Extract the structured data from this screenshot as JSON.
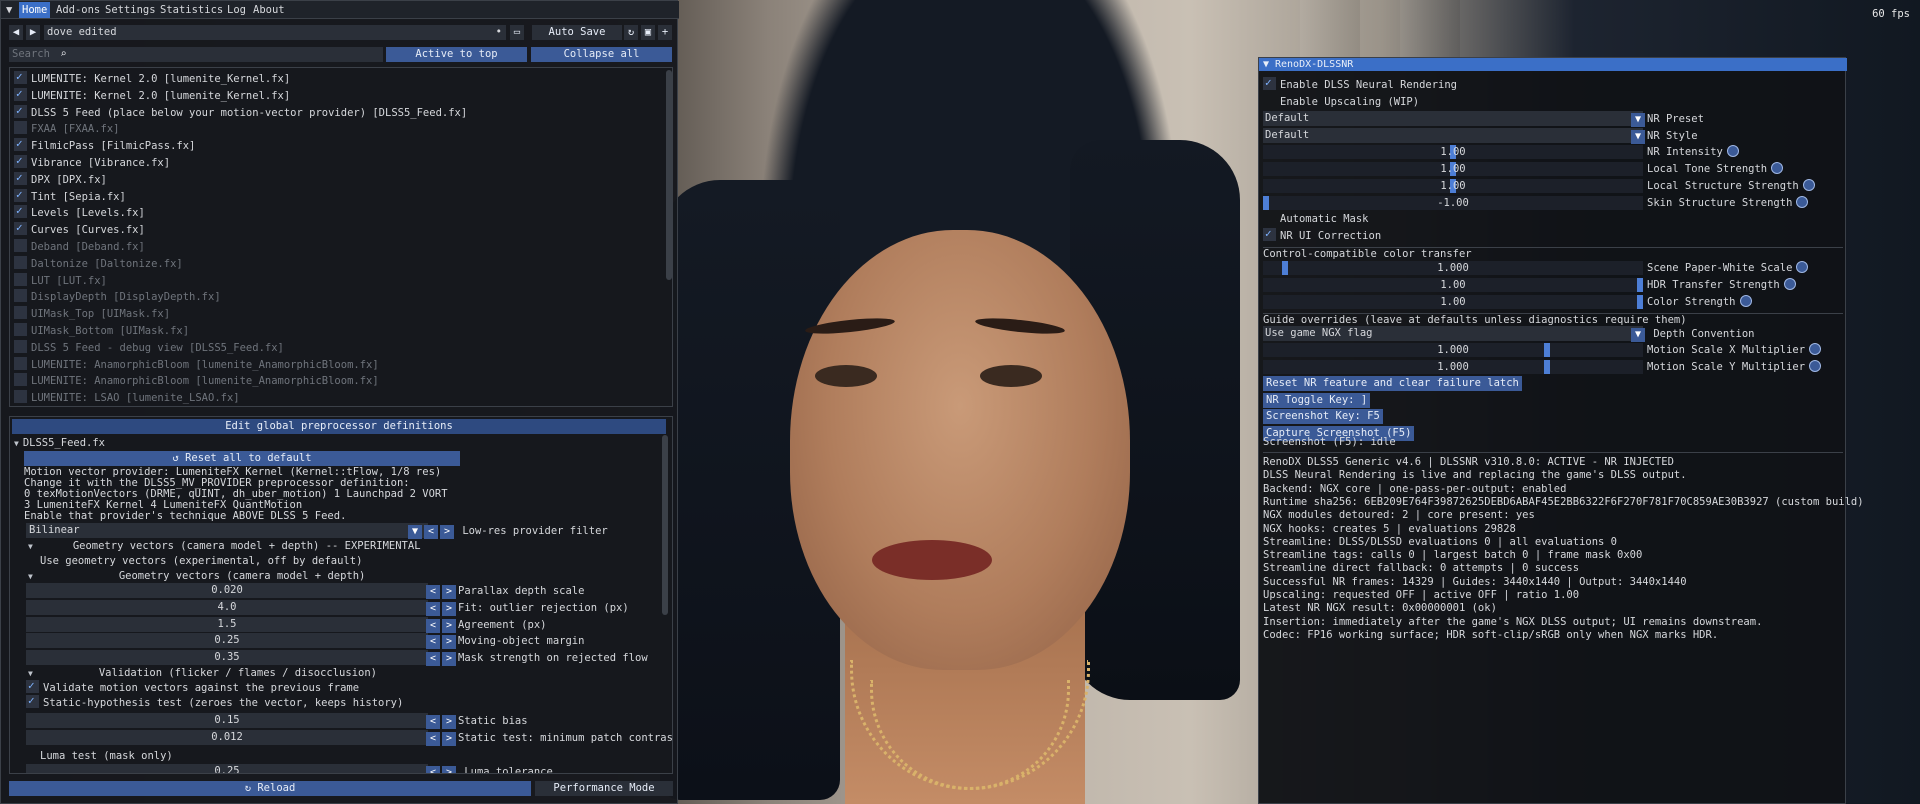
{
  "fps": "60 fps",
  "reshade": {
    "menu": [
      "Home",
      "Add-ons",
      "Settings",
      "Statistics",
      "Log",
      "About"
    ],
    "preset_name": "dove edited",
    "auto_save": "Auto Save",
    "search_placeholder": "Search",
    "active_to_top": "Active to top",
    "collapse_all": "Collapse all",
    "effects": [
      {
        "label": "LUMENITE: Kernel 2.0 [lumenite_Kernel.fx]",
        "on": true
      },
      {
        "label": "LUMENITE: Kernel 2.0 [lumenite_Kernel.fx]",
        "on": true
      },
      {
        "label": "DLSS 5 Feed (place below your motion-vector provider) [DLSS5_Feed.fx]",
        "on": true
      },
      {
        "label": "FXAA [FXAA.fx]",
        "on": false
      },
      {
        "label": "FilmicPass [FilmicPass.fx]",
        "on": true
      },
      {
        "label": "Vibrance [Vibrance.fx]",
        "on": true
      },
      {
        "label": "DPX [DPX.fx]",
        "on": true
      },
      {
        "label": "Tint [Sepia.fx]",
        "on": true
      },
      {
        "label": "Levels [Levels.fx]",
        "on": true
      },
      {
        "label": "Curves [Curves.fx]",
        "on": true
      },
      {
        "label": "Deband [Deband.fx]",
        "on": false
      },
      {
        "label": "Daltonize [Daltonize.fx]",
        "on": false
      },
      {
        "label": "LUT [LUT.fx]",
        "on": false
      },
      {
        "label": "DisplayDepth [DisplayDepth.fx]",
        "on": false
      },
      {
        "label": "UIMask_Top [UIMask.fx]",
        "on": false
      },
      {
        "label": "UIMask_Bottom [UIMask.fx]",
        "on": false
      },
      {
        "label": "DLSS 5 Feed - debug view [DLSS5_Feed.fx]",
        "on": false
      },
      {
        "label": "LUMENITE: AnamorphicBloom [lumenite_AnamorphicBloom.fx]",
        "on": false
      },
      {
        "label": "LUMENITE: AnamorphicBloom [lumenite_AnamorphicBloom.fx]",
        "on": false
      },
      {
        "label": "LUMENITE: LSAO [lumenite_LSAO.fx]",
        "on": false
      }
    ],
    "edit_global": "Edit global preprocessor definitions",
    "section_file": "DLSS5_Feed.fx",
    "reset_all": "Reset all to default",
    "info_lines": [
      "Motion vector provider: LumeniteFX Kernel (Kernel::tFlow, 1/8 res)",
      "Change it with the DLSS5_MV_PROVIDER preprocessor definition:",
      "  0 texMotionVectors (DRME, qUINT, dh_uber_motion)   1 Launchpad   2 VORT",
      "  3 LumeniteFX Kernel    4 LumeniteFX QuantMotion",
      "Enable that provider's technique ABOVE DLSS 5 Feed."
    ],
    "lowres_value": "Bilinear",
    "lowres_label": "Low-res provider filter",
    "geo_header_exp": "Geometry vectors (camera model + depth) -- EXPERIMENTAL",
    "use_geo": "Use geometry vectors (experimental, off by default)",
    "geo_header": "Geometry vectors (camera model + depth)",
    "params_geo": [
      {
        "value": "0.020",
        "label": "Parallax depth scale"
      },
      {
        "value": "4.0",
        "label": "Fit: outlier rejection (px)"
      },
      {
        "value": "1.5",
        "label": "Agreement (px)"
      },
      {
        "value": "0.25",
        "label": "Moving-object margin"
      },
      {
        "value": "0.35",
        "label": "Mask strength on rejected flow"
      }
    ],
    "validation_header": "Validation (flicker / flames / disocclusion)",
    "validate_mv": "Validate motion vectors against the previous frame",
    "static_hyp": "Static-hypothesis test (zeroes the vector, keeps history)",
    "params_static": [
      {
        "value": "0.15",
        "label": "Static bias"
      },
      {
        "value": "0.012",
        "label": "Static test: minimum patch contrast"
      }
    ],
    "luma_test": "Luma test (mask only)",
    "luma_tol_value": "0.25",
    "luma_tol_label": "Luma tolerance",
    "reload": "Reload",
    "perf_mode": "Performance Mode"
  },
  "renodx": {
    "title": "RenoDX-DLSSNR",
    "enable_nr": "Enable DLSS Neural Rendering",
    "enable_upscaling": "Enable Upscaling (WIP)",
    "combos": [
      {
        "value": "Default",
        "label": "NR Preset"
      },
      {
        "value": "Default",
        "label": "NR Style"
      }
    ],
    "sliders_a": [
      {
        "value": "1.00",
        "label": "NR Intensity",
        "frac": 0.5
      },
      {
        "value": "1.00",
        "label": "Local Tone Strength",
        "frac": 0.5
      },
      {
        "value": "1.00",
        "label": "Local Structure Strength",
        "frac": 0.5
      },
      {
        "value": "-1.00",
        "label": "Skin Structure Strength",
        "frac": 0.0
      }
    ],
    "auto_mask": "Automatic Mask",
    "nr_ui": "NR UI Correction",
    "color_transfer_header": "Control-compatible color transfer",
    "sliders_b": [
      {
        "value": "1.000",
        "label": "Scene Paper-White Scale",
        "frac": 0.05
      },
      {
        "value": "1.00",
        "label": "HDR Transfer Strength",
        "frac": 1.0
      },
      {
        "value": "1.00",
        "label": "Color Strength",
        "frac": 1.0
      }
    ],
    "guide_header": "Guide overrides (leave at defaults unless diagnostics require them)",
    "depth_value": "Use game NGX flag",
    "depth_label": "Depth Convention",
    "sliders_c": [
      {
        "value": "1.000",
        "label": "Motion Scale X Multiplier",
        "frac": 0.75
      },
      {
        "value": "1.000",
        "label": "Motion Scale Y Multiplier",
        "frac": 0.75
      }
    ],
    "buttons": [
      "Reset NR feature and clear failure latch",
      "NR Toggle Key: ]",
      "Screenshot Key: F5",
      "Capture Screenshot (F5)"
    ],
    "screenshot_status": "Screenshot (F5): idle",
    "status_lines": [
      "RenoDX DLSS5 Generic v4.6 | DLSSNR v310.8.0: ACTIVE - NR INJECTED",
      "DLSS Neural Rendering is live and replacing the game's DLSS output.",
      "Backend: NGX core | one-pass-per-output: enabled",
      "Runtime sha256: 6EB209E764F39872625DEBD6ABAF45E2BB6322F6F270F781F70C859AE30B3927 (custom build)",
      "NGX modules detoured: 2 | core present: yes",
      "NGX hooks: creates 5 | evaluations 29828",
      "Streamline: DLSS/DLSSD evaluations 0 | all evaluations 0",
      "Streamline tags: calls 0 | largest batch 0 | frame mask 0x00",
      "Streamline direct fallback: 0 attempts | 0 success",
      "Successful NR frames: 14329 | Guides: 3440x1440 | Output: 3440x1440",
      "Upscaling: requested OFF | active OFF | ratio 1.00",
      "Latest NR NGX result: 0x00000001 (ok)",
      "Insertion: immediately after the game's NGX DLSS output; UI remains downstream.",
      "Codec: FP16 working surface; HDR soft-clip/sRGB only when NGX marks HDR."
    ]
  }
}
